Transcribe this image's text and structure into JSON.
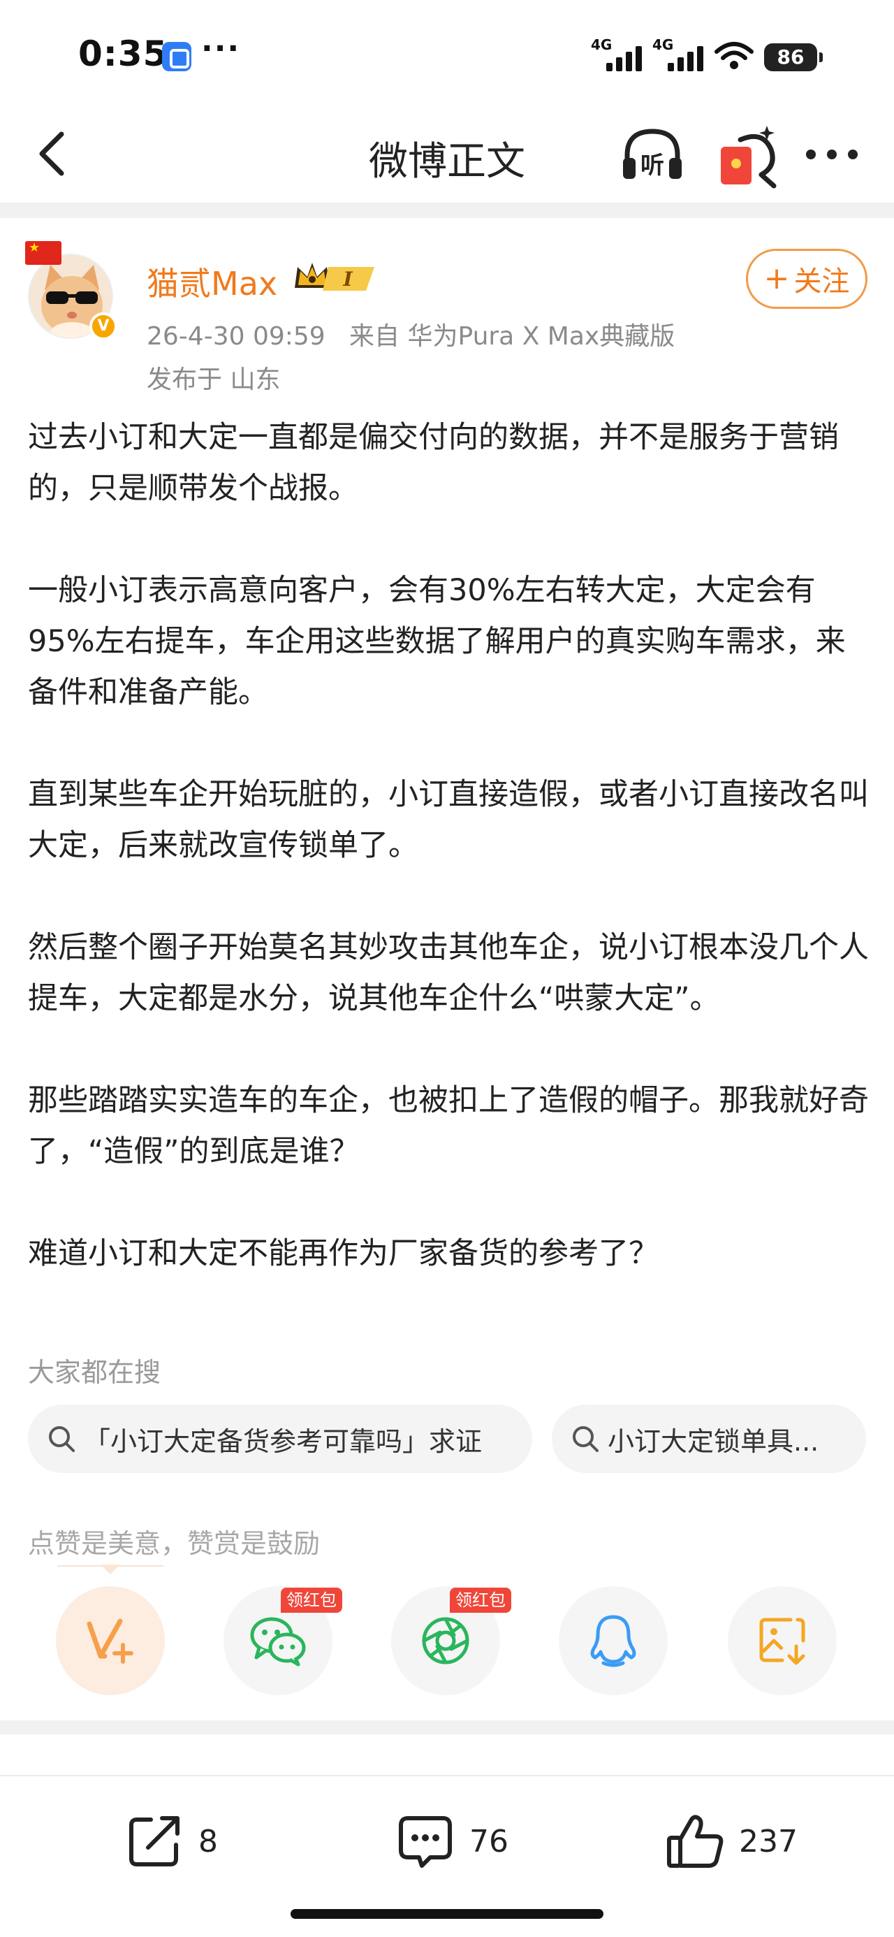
{
  "status_bar": {
    "time": "0:35",
    "dots": "···",
    "network1": "4G",
    "network2": "4G",
    "battery": "86"
  },
  "nav": {
    "title": "微博正文",
    "listen_label": "听"
  },
  "post": {
    "username": "猫贰Max",
    "vip_level": "I",
    "date": "26-4-30 09:59",
    "source": "来自 华为Pura X Max典藏版",
    "location": "发布于 山东",
    "follow_label": "关注",
    "paragraphs": [
      "过去小订和大定一直都是偏交付向的数据，并不是服务于营销的，只是顺带发个战报。",
      "一般小订表示高意向客户，会有30%左右转大定，大定会有95%左右提车，车企用这些数据了解用户的真实购车需求，来备件和准备产能。",
      "直到某些车企开始玩脏的，小订直接造假，或者小订直接改名叫大定，后来就改宣传锁单了。",
      "然后整个圈子开始莫名其妙攻击其他车企，说小订根本没几个人提车，大定都是水分，说其他车企什么“哄蒙大定”。",
      "那些踏踏实实造车的车企，也被扣上了造假的帽子。那我就好奇了，“造假”的到底是谁？",
      "难道小订和大定不能再作为厂家备货的参考了？"
    ]
  },
  "search": {
    "label": "大家都在搜",
    "chips": [
      "「小订大定备货参考可靠吗」求证",
      "小订大定锁单具..."
    ]
  },
  "reward": {
    "tip": "点赞是美意，赞赏是鼓励",
    "tag_label": "领红包"
  },
  "actions": {
    "repost_count": "8",
    "comment_count": "76",
    "like_count": "237"
  },
  "colors": {
    "accent": "#f07a1d",
    "red_tag": "#f0463a",
    "wechat_green": "#2bb55c",
    "qq_blue": "#3a9cf5",
    "gallery_orange": "#f5a623"
  }
}
